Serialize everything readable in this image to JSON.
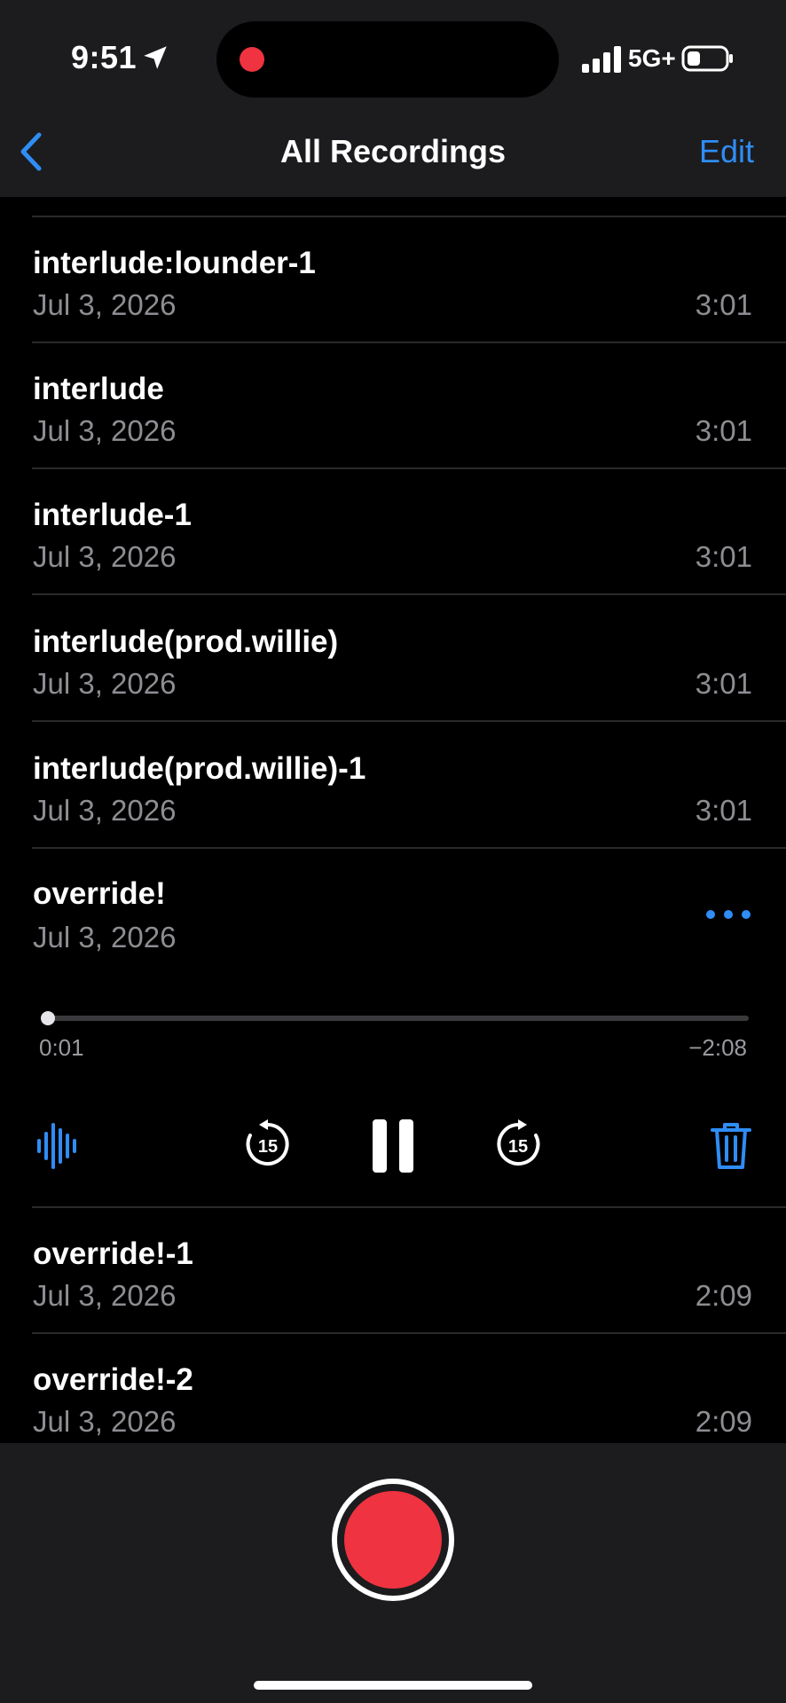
{
  "status_bar": {
    "time": "9:51",
    "network": "5G+",
    "icons": [
      "location-arrow-icon",
      "recording-dot-icon",
      "signal-bars-icon",
      "battery-icon"
    ]
  },
  "nav": {
    "title": "All Recordings",
    "edit_label": "Edit",
    "back_icon": "chevron-left-icon"
  },
  "recordings": [
    {
      "title": "interlude:lounder-1",
      "date": "Jul 3, 2026",
      "duration": "3:01"
    },
    {
      "title": "interlude",
      "date": "Jul 3, 2026",
      "duration": "3:01"
    },
    {
      "title": "interlude-1",
      "date": "Jul 3, 2026",
      "duration": "3:01"
    },
    {
      "title": "interlude(prod.willie)",
      "date": "Jul 3, 2026",
      "duration": "3:01"
    },
    {
      "title": "interlude(prod.willie)-1",
      "date": "Jul 3, 2026",
      "duration": "3:01"
    }
  ],
  "expanded": {
    "title": "override!",
    "date": "Jul 3, 2026",
    "elapsed": "0:01",
    "remaining": "−2:08",
    "progress": 0.008,
    "controls": [
      "waveform-icon",
      "skip-back-15-icon",
      "pause-icon",
      "skip-forward-15-icon",
      "trash-icon"
    ],
    "skip_seconds": "15"
  },
  "recordings_after": [
    {
      "title": "override!-1",
      "date": "Jul 3, 2026",
      "duration": "2:09"
    },
    {
      "title": "override!-2",
      "date": "Jul 3, 2026",
      "duration": "2:09"
    }
  ],
  "colors": {
    "accent": "#2f8df5",
    "record": "#ef3340",
    "background": "#000000",
    "bar": "#1c1c1e"
  }
}
